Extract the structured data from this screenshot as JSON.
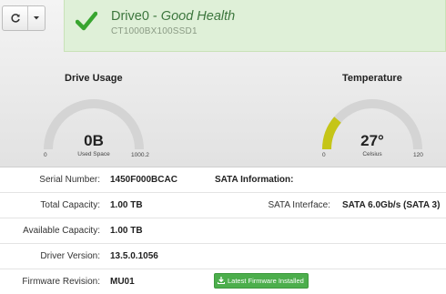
{
  "toolbar": {
    "refresh_icon": "refresh-icon",
    "caret_icon": "caret-down-icon"
  },
  "health": {
    "drive": "Drive0",
    "separator": " - ",
    "status": "Good Health",
    "model": "CT1000BX100SSD1",
    "status_color": "#3c763d",
    "icon": "checkmark-icon"
  },
  "usage": {
    "title": "Drive Usage",
    "value": "0B",
    "unit": "Used Space",
    "min": "0",
    "max": "1000.2",
    "fill_fraction": 0.0,
    "color": "#cccccc"
  },
  "temperature": {
    "title": "Temperature",
    "value": "27°",
    "unit": "Celsius",
    "min": "0",
    "max": "120",
    "fill_fraction": 0.225,
    "color": "#c5c518"
  },
  "info": {
    "serial": {
      "label": "Serial Number:",
      "value": "1450F000BCAC"
    },
    "sata_header": "SATA Information:",
    "total": {
      "label": "Total Capacity:",
      "value": "1.00 TB"
    },
    "sata_interface": {
      "label": "SATA Interface:",
      "value": "SATA 6.0Gb/s (SATA 3)"
    },
    "available": {
      "label": "Available Capacity:",
      "value": "1.00 TB"
    },
    "driver": {
      "label": "Driver Version:",
      "value": "13.5.0.1056"
    },
    "firmware": {
      "label": "Firmware Revision:",
      "value": "MU01"
    },
    "firmware_button": "Latest Firmware Installed",
    "firmware_button_icon": "download-icon"
  }
}
